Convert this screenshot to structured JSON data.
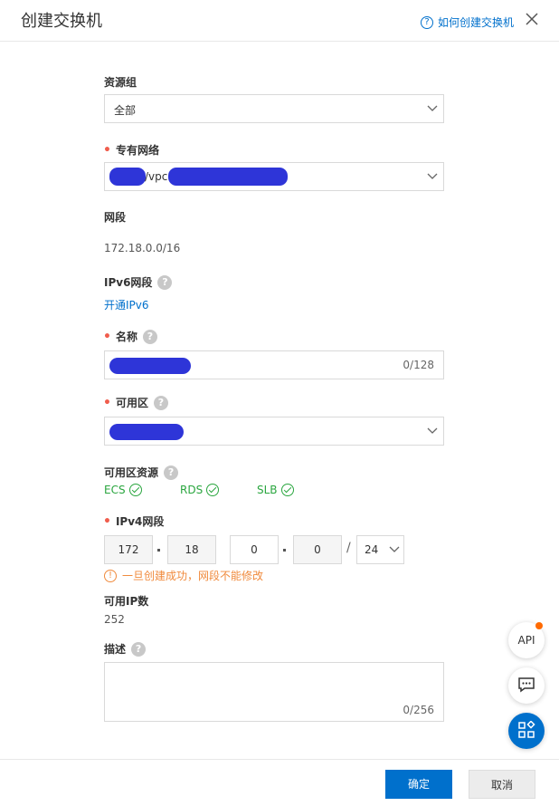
{
  "dialog": {
    "title": "创建交换机",
    "help_link": "如何创建交换机",
    "help_icon": "question-circle-icon",
    "close_icon": "close-icon"
  },
  "form": {
    "resource_group": {
      "label": "资源组",
      "value": "全部"
    },
    "vpc": {
      "label": "专有网络",
      "value_prefix": "/vpc-"
    },
    "cidr": {
      "label": "网段",
      "value": "172.18.0.0/16"
    },
    "ipv6": {
      "label": "IPv6网段",
      "link": "开通IPv6"
    },
    "name": {
      "label": "名称",
      "count": "0/128"
    },
    "zone": {
      "label": "可用区"
    },
    "zone_resources": {
      "label": "可用区资源",
      "items": [
        "ECS",
        "RDS",
        "SLB"
      ]
    },
    "ipv4": {
      "label": "IPv4网段",
      "octets": [
        "172",
        "18",
        "0",
        "0"
      ],
      "slash": "/",
      "mask": "24",
      "warning": "一旦创建成功，网段不能修改"
    },
    "available_ip": {
      "label": "可用IP数",
      "value": "252"
    },
    "description": {
      "label": "描述",
      "count": "0/256"
    }
  },
  "footer": {
    "ok": "确定",
    "cancel": "取消"
  },
  "floating": {
    "api": "API",
    "chat_icon": "chat-icon",
    "apps_icon": "apps-icon"
  },
  "colors": {
    "primary": "#0070cc",
    "required": "#f05d4d",
    "success": "#2aa63f",
    "warning": "#f08a3c",
    "redaction": "#2e35d8"
  }
}
